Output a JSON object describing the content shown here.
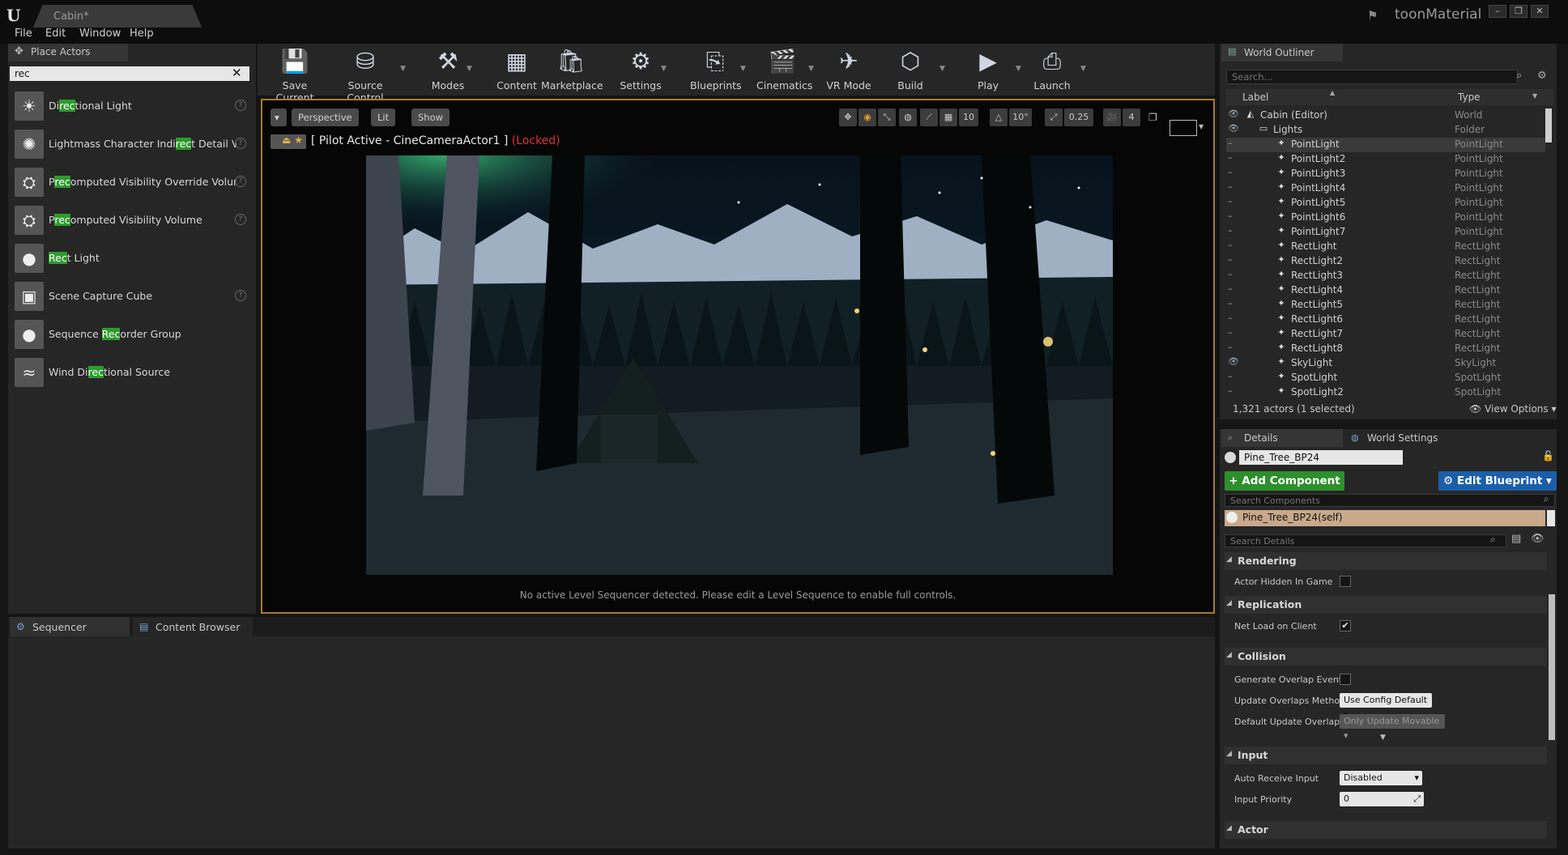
{
  "window": {
    "tab_title": "Cabin",
    "project": "toonMaterial"
  },
  "menu": [
    "File",
    "Edit",
    "Window",
    "Help"
  ],
  "place_actors": {
    "tab": "Place Actors",
    "search_value": "rec",
    "items": [
      {
        "pre": "Di",
        "hl": "rec",
        "post": "tional Light",
        "help": true
      },
      {
        "pre": "Lightmass Character Indi",
        "hl": "rec",
        "post": "t Detail Vol",
        "help": true
      },
      {
        "pre": "P",
        "hl": "rec",
        "post": "omputed Visibility Override Volume",
        "help": true
      },
      {
        "pre": "P",
        "hl": "rec",
        "post": "omputed Visibility Volume",
        "help": true
      },
      {
        "pre": "",
        "hl": "Rec",
        "post": "t Light",
        "help": false
      },
      {
        "pre": "Scene Capture Cube",
        "hl": "",
        "post": "",
        "help": true
      },
      {
        "pre": "Sequence ",
        "hl": "Rec",
        "post": "order Group",
        "help": false
      },
      {
        "pre": "Wind Di",
        "hl": "rec",
        "post": "tional Source",
        "help": false
      }
    ]
  },
  "toolbar": {
    "save": "Save Current",
    "source": "Source Control",
    "modes": "Modes",
    "content": "Content",
    "marketplace": "Marketplace",
    "settings": "Settings",
    "blueprints": "Blueprints",
    "cinematics": "Cinematics",
    "vrmode": "VR Mode",
    "build": "Build",
    "play": "Play",
    "launch": "Launch"
  },
  "viewport": {
    "perspective": "Perspective",
    "lit": "Lit",
    "show": "Show",
    "grid": "10",
    "angle": "10°",
    "scale": "0.25",
    "speed": "4",
    "pilot": "[ Pilot Active - CineCameraActor1 ]",
    "locked": "(Locked)",
    "message": "No active Level Sequencer detected. Please edit a Level Sequence to enable full controls."
  },
  "bottom_tabs": {
    "sequencer": "Sequencer",
    "content_browser": "Content Browser"
  },
  "outliner": {
    "tab": "World Outliner",
    "search_placeholder": "Search...",
    "col_label": "Label",
    "col_type": "Type",
    "rows": [
      {
        "label": "Cabin (Editor)",
        "type": "World",
        "indent": 0
      },
      {
        "label": "Lights",
        "type": "Folder",
        "indent": 1
      },
      {
        "label": "PointLight",
        "type": "PointLight",
        "indent": 2
      },
      {
        "label": "PointLight2",
        "type": "PointLight",
        "indent": 2
      },
      {
        "label": "PointLight3",
        "type": "PointLight",
        "indent": 2
      },
      {
        "label": "PointLight4",
        "type": "PointLight",
        "indent": 2
      },
      {
        "label": "PointLight5",
        "type": "PointLight",
        "indent": 2
      },
      {
        "label": "PointLight6",
        "type": "PointLight",
        "indent": 2
      },
      {
        "label": "PointLight7",
        "type": "PointLight",
        "indent": 2
      },
      {
        "label": "RectLight",
        "type": "RectLight",
        "indent": 2
      },
      {
        "label": "RectLight2",
        "type": "RectLight",
        "indent": 2
      },
      {
        "label": "RectLight3",
        "type": "RectLight",
        "indent": 2
      },
      {
        "label": "RectLight4",
        "type": "RectLight",
        "indent": 2
      },
      {
        "label": "RectLight5",
        "type": "RectLight",
        "indent": 2
      },
      {
        "label": "RectLight6",
        "type": "RectLight",
        "indent": 2
      },
      {
        "label": "RectLight7",
        "type": "RectLight",
        "indent": 2
      },
      {
        "label": "RectLight8",
        "type": "RectLight",
        "indent": 2
      },
      {
        "label": "SkyLight",
        "type": "SkyLight",
        "indent": 2
      },
      {
        "label": "SpotLight",
        "type": "SpotLight",
        "indent": 2
      },
      {
        "label": "SpotLight2",
        "type": "SpotLight",
        "indent": 2
      }
    ],
    "footer": "1,321 actors (1 selected)",
    "view_options": "View Options"
  },
  "details": {
    "tab": "Details",
    "world_settings_tab": "World Settings",
    "name": "Pine_Tree_BP24",
    "add_component": "+ Add Component",
    "edit_blueprint": "Edit Blueprint",
    "search_components": "Search Components",
    "self_component": "Pine_Tree_BP24(self)",
    "search_details": "Search Details",
    "rendering": "Rendering",
    "actor_hidden": "Actor Hidden In Game",
    "replication": "Replication",
    "net_load": "Net Load on Client",
    "collision": "Collision",
    "gen_overlap": "Generate Overlap Events",
    "update_overlaps": "Update Overlaps Method",
    "update_overlaps_val": "Use Config Default",
    "default_update": "Default Update Overlaps",
    "default_update_val": "Only Update Movable",
    "input": "Input",
    "auto_receive": "Auto Receive Input",
    "auto_receive_val": "Disabled",
    "input_priority": "Input Priority",
    "input_priority_val": "0",
    "actor": "Actor"
  }
}
